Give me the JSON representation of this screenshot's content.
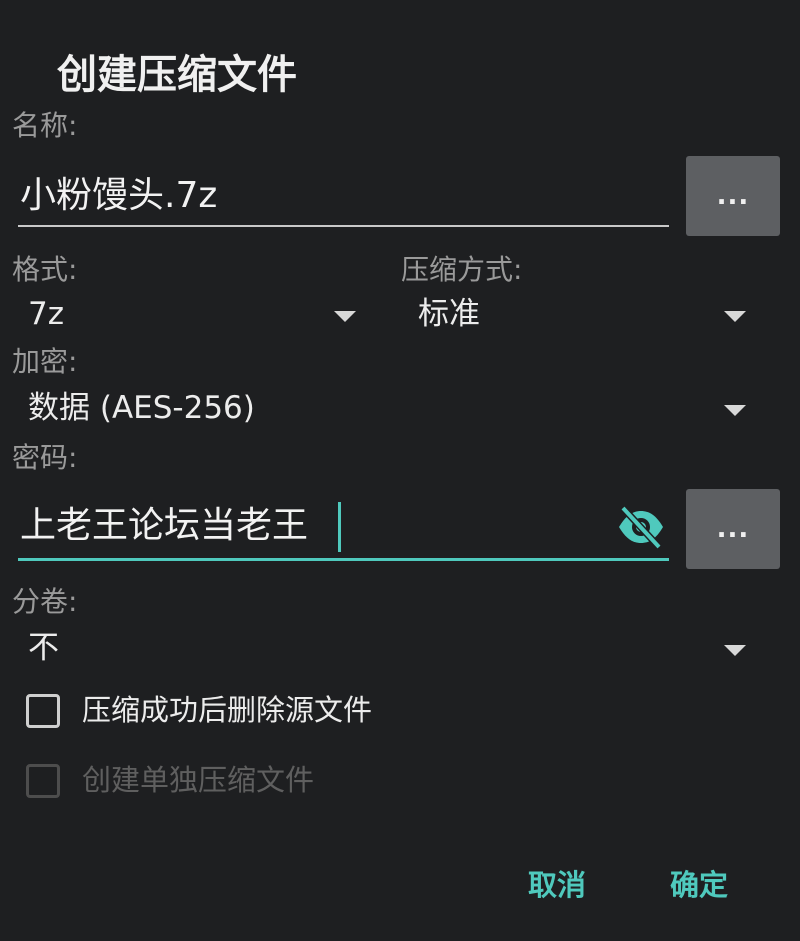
{
  "dialog": {
    "title": "创建压缩文件"
  },
  "name_field": {
    "label": "名称:",
    "value": "小粉馒头.7z",
    "browse_label": "..."
  },
  "format": {
    "label": "格式:",
    "selected": "7z"
  },
  "compression": {
    "label": "压缩方式:",
    "selected": "标准"
  },
  "encryption": {
    "label": "加密:",
    "selected": "数据 (AES-256)"
  },
  "password": {
    "label": "密码:",
    "value": "上老王论坛当老王",
    "browse_label": "...",
    "visibility_icon": "eye-off-icon"
  },
  "split": {
    "label": "分卷:",
    "selected": "不"
  },
  "options": {
    "delete_source": {
      "label": "压缩成功后删除源文件",
      "checked": false,
      "enabled": true
    },
    "separate_archives": {
      "label": "创建单独压缩文件",
      "checked": false,
      "enabled": false
    }
  },
  "actions": {
    "cancel": "取消",
    "ok": "确定"
  },
  "colors": {
    "background": "#1e1f21",
    "accent": "#4fc9bd",
    "button_bg": "#5d5f62"
  }
}
